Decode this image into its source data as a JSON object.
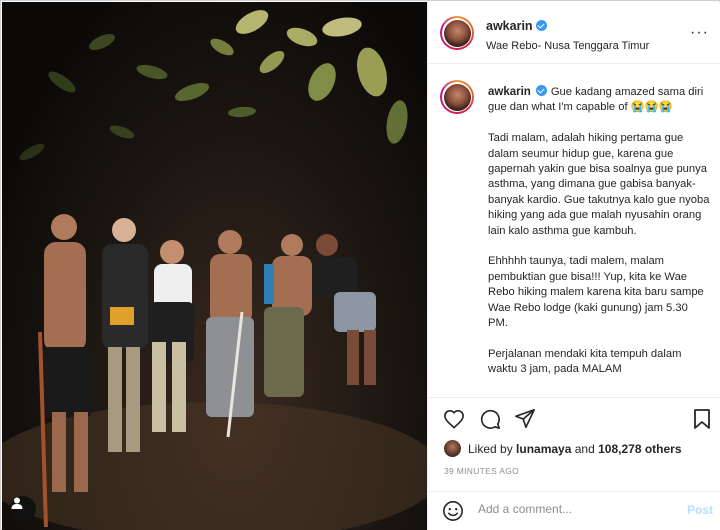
{
  "post": {
    "username": "awkarin",
    "location": "Wae Rebo- Nusa Tenggara Timur",
    "caption_paragraphs": [
      "Gue kadang amazed sama diri gue dan what I'm capable of 😭😭😭",
      "Tadi malam, adalah hiking pertama gue dalam seumur hidup gue, karena gue gapernah yakin gue bisa soalnya gue punya asthma, yang dimana gue gabisa banyak-banyak kardio. Gue takutnya kalo gue nyoba hiking yang ada gue malah nyusahin orang lain kalo asthma gue kambuh.",
      "Ehhhhh taunya, tadi malem, malam pembuktian gue bisa!!! Yup, kita ke Wae Rebo hiking malem karena kita baru sampe Wae Rebo lodge (kaki gunung) jam 5.30 PM.",
      "Perjalanan mendaki kita tempuh dalam waktu 3 jam, pada MALAM"
    ],
    "likes": {
      "liked_by": "lunamaya",
      "others": "108,278 others",
      "prefix": "Liked by",
      "connector": "and"
    },
    "timestamp": "39 MINUTES AGO",
    "comment": {
      "placeholder": "Add a comment...",
      "post_label": "Post"
    }
  },
  "icons": {
    "like": "heart-icon",
    "comment": "comment-icon",
    "share": "paper-plane-icon",
    "save": "bookmark-icon",
    "emoji": "smiley-icon",
    "tag": "user-tag-icon",
    "more": "more-dots-icon",
    "verified": "verified-badge-icon"
  },
  "colors": {
    "verified": "#3897f0",
    "post_disabled": "#b2dffc",
    "muted_text": "#8e8e8e"
  }
}
